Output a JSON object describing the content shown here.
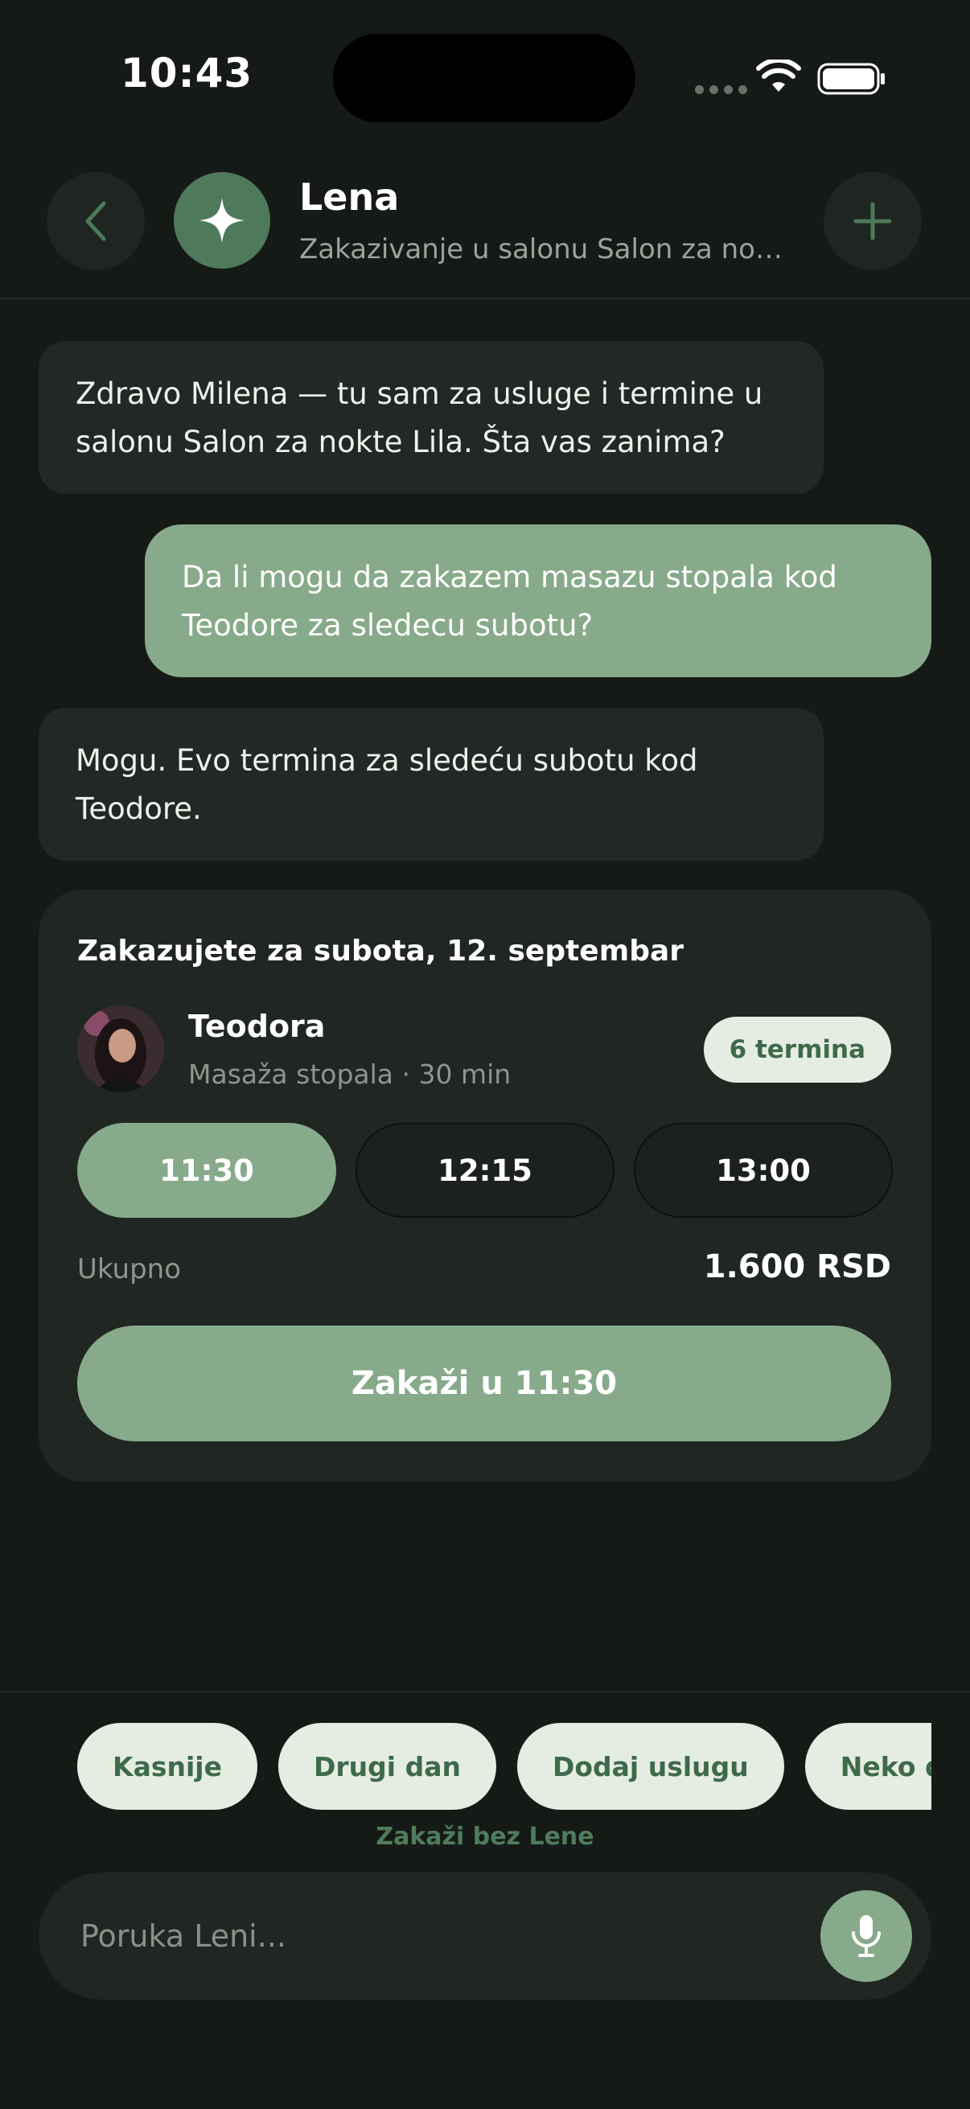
{
  "status_bar": {
    "time": "10:43"
  },
  "header": {
    "title": "Lena",
    "subtitle": "Zakazivanje u salonu Salon za nokt..."
  },
  "messages": [
    {
      "role": "assistant",
      "text": "Zdravo Milena — tu sam za usluge i termine u salonu Salon za nokte Lila. Šta vas zanima?"
    },
    {
      "role": "user",
      "text": "Da li mogu da zakazem masazu stopala kod Teodore za sledecu subotu?"
    },
    {
      "role": "assistant",
      "text": "Mogu. Evo termina za sledeću subotu kod Teodore."
    }
  ],
  "booking_card": {
    "title": "Zakazujete za subota, 12. septembar",
    "staff_name": "Teodora",
    "service": "Masaža stopala · 30 min",
    "slots_badge": "6 termina",
    "slots": [
      "11:30",
      "12:15",
      "13:00"
    ],
    "selected_slot": "11:30",
    "total_label": "Ukupno",
    "total_value": "1.600 RSD",
    "book_button": "Zakaži u 11:30"
  },
  "quick_replies": [
    "Kasnije",
    "Drugi dan",
    "Dodaj uslugu",
    "Neko drugi"
  ],
  "no_lena_link": "Zakaži bez Lene",
  "composer": {
    "placeholder": "Poruka Leni..."
  },
  "colors": {
    "background": "#161a17",
    "surface": "#202622",
    "accent": "#87aa8a",
    "chip_bg": "#e5ede3",
    "chip_text": "#3f6a49"
  }
}
